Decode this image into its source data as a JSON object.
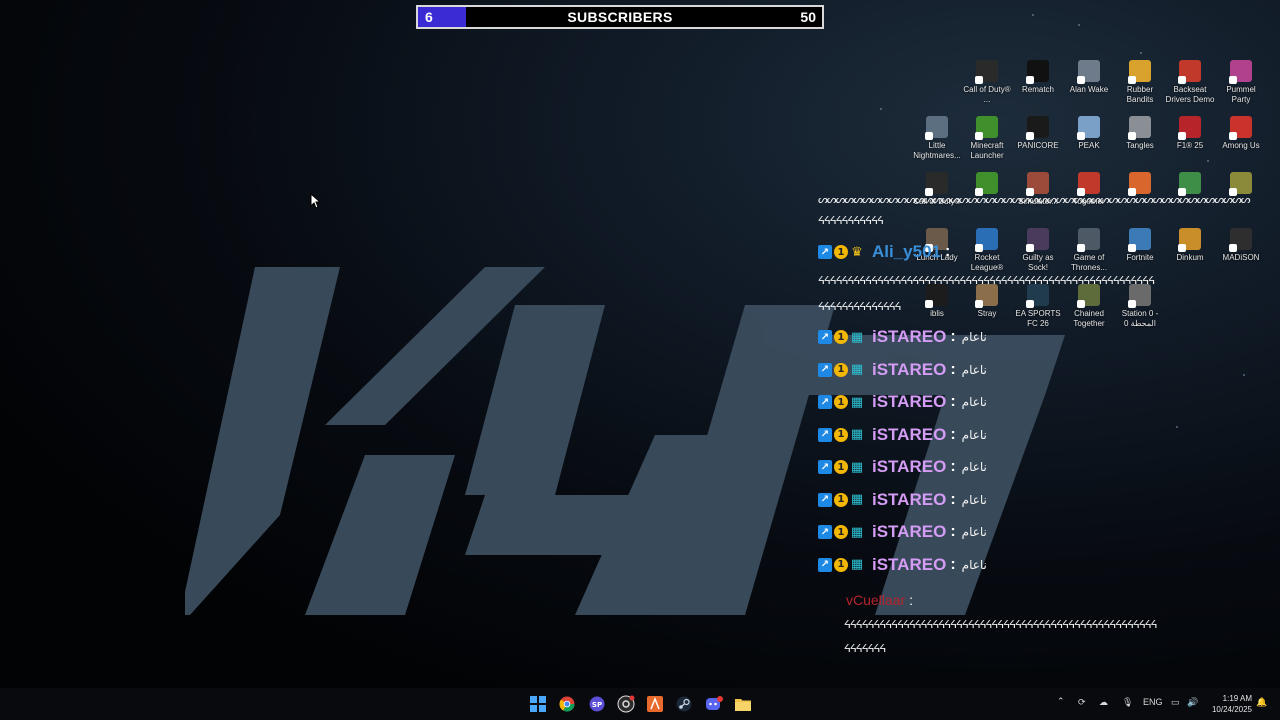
{
  "subscriber_goal": {
    "current": "6",
    "label": "SUBSCRIBERS",
    "target": "50",
    "progress_fraction": 0.12,
    "fill_color": "#3b2bd4"
  },
  "desktop_icons": [
    {
      "label": "Call of Duty® ...",
      "icon": "call-of-duty-icon",
      "color": "#2a2a2a"
    },
    {
      "label": "Rematch",
      "icon": "rematch-icon",
      "color": "#111111"
    },
    {
      "label": "Alan Wake",
      "icon": "alan-wake-icon",
      "color": "#6d7b8a"
    },
    {
      "label": "Rubber Bandits",
      "icon": "rubber-bandits-icon",
      "color": "#d9a22c"
    },
    {
      "label": "Backseat Drivers Demo",
      "icon": "backseat-drivers-icon",
      "color": "#c0392b"
    },
    {
      "label": "Pummel Party",
      "icon": "pummel-party-icon",
      "color": "#b0418c"
    },
    {
      "label": "Little Nightmares...",
      "icon": "little-nightmares-icon",
      "color": "#5b6f80"
    },
    {
      "label": "Minecraft Launcher",
      "icon": "minecraft-icon",
      "color": "#3f8f2d"
    },
    {
      "label": "PANICORE",
      "icon": "panicore-icon",
      "color": "#1a1a1a"
    },
    {
      "label": "PEAK",
      "icon": "peak-icon",
      "color": "#7aa0c8"
    },
    {
      "label": "Tangles",
      "icon": "tangles-icon",
      "color": "#8a8f96"
    },
    {
      "label": "F1® 25",
      "icon": "f1-icon",
      "color": "#b7252b"
    },
    {
      "label": "Among Us",
      "icon": "among-us-icon",
      "color": "#c9332b"
    },
    {
      "label": "Call of Duty®",
      "icon": "call-of-duty-icon",
      "color": "#2a2a2a"
    },
    {
      "label": "",
      "icon": "minecraft-icon",
      "color": "#3f8f2d"
    },
    {
      "label": "Simulator...",
      "icon": "simulator-icon",
      "color": "#9c4b3a"
    },
    {
      "label": "Together",
      "icon": "together-icon",
      "color": "#c0392b"
    },
    {
      "label": "",
      "icon": "game-icon",
      "color": "#d9662c"
    },
    {
      "label": "",
      "icon": "game-icon",
      "color": "#3e8e47"
    },
    {
      "label": "",
      "icon": "game-icon",
      "color": "#8a8a3a"
    },
    {
      "label": "Lunch Lady",
      "icon": "lunch-lady-icon",
      "color": "#6b5a4a"
    },
    {
      "label": "Rocket League®",
      "icon": "rocket-league-icon",
      "color": "#2a6fb5"
    },
    {
      "label": "Guilty as Sock!",
      "icon": "guilty-as-sock-icon",
      "color": "#4a3b5c"
    },
    {
      "label": "Game of Thrones...",
      "icon": "game-of-thrones-icon",
      "color": "#4d5a66"
    },
    {
      "label": "Fortnite",
      "icon": "fortnite-icon",
      "color": "#3b7ab5"
    },
    {
      "label": "Dinkum",
      "icon": "dinkum-icon",
      "color": "#c98d2a"
    },
    {
      "label": "MADiSON",
      "icon": "madison-icon",
      "color": "#2e2e2e"
    },
    {
      "label": "iblis",
      "icon": "iblis-icon",
      "color": "#1c1c1c"
    },
    {
      "label": "Stray",
      "icon": "stray-icon",
      "color": "#8b6e4a"
    },
    {
      "label": "EA SPORTS FC 26",
      "icon": "ea-fc-icon",
      "color": "#1f3b4d"
    },
    {
      "label": "Chained Together",
      "icon": "chained-together-icon",
      "color": "#5e6b3a"
    },
    {
      "label": "Station 0 - المحطة 0",
      "icon": "station-0-icon",
      "color": "#6a6a6a"
    }
  ],
  "chat": {
    "spam_line_1": "ᔕᔕᔕᔕᔕᔕᔕᔕᔕᔕᔕᔕᔕᔕᔕᔕᔕᔕᔕᔕᔕᔕᔕᔕᔕᔕᔕᔕᔕᔕᔕᔕᔕᔕᔕᔕᔕᔕᔕᔕᔕᔕᔕᔕᔕᔕᔕᔕᔕ",
    "spam_line_2": "ᔦᔦᔦᔦᔦᔦᔦᔦᔦᔦᔦ",
    "ali": {
      "name": "Ali_y501",
      "color": "#3a8fd9",
      "colon": ":"
    },
    "spam_line_3": "ᔦᔦᔦᔦᔦᔦᔦᔦᔦᔦᔦᔦᔦᔦᔦᔦᔦᔦᔦᔦᔦᔦᔦᔦᔦᔦᔦᔦᔦᔦᔦᔦᔦᔦᔦᔦᔦᔦᔦᔦᔦᔦᔦᔦᔦᔦᔦᔦᔦᔦᔦᔦᔦᔦᔦᔦᔦ",
    "spam_line_4": "ᔦᔦᔦᔦᔦᔦᔦᔦᔦᔦᔦᔦᔦᔦ",
    "istareo_messages": [
      {
        "name": "iSTAREO",
        "colon": ":",
        "text": "ناعام"
      },
      {
        "name": "iSTAREO",
        "colon": ":",
        "text": "ناعام"
      },
      {
        "name": "iSTAREO",
        "colon": ":",
        "text": "ناعام"
      },
      {
        "name": "iSTAREO",
        "colon": ":",
        "text": "ناعام"
      },
      {
        "name": "iSTAREO",
        "colon": ":",
        "text": "ناعام"
      },
      {
        "name": "iSTAREO",
        "colon": ":",
        "text": "ناعام"
      },
      {
        "name": "iSTAREO",
        "colon": ":",
        "text": "ناعام"
      },
      {
        "name": "iSTAREO",
        "colon": ":",
        "text": "ناعام"
      }
    ],
    "istareo_color": "#d59cf5",
    "cuellaar": {
      "name": "vCuellaar",
      "color": "#b8252e",
      "colon": ":"
    },
    "spam_line_5": "ᔦᔦᔦᔦᔦᔦᔦᔦᔦᔦᔦᔦᔦᔦᔦᔦᔦᔦᔦᔦᔦᔦᔦᔦᔦᔦᔦᔦᔦᔦᔦᔦᔦᔦᔦᔦᔦᔦᔦᔦᔦᔦᔦᔦᔦᔦᔦᔦᔦᔦᔦᔦᔦ",
    "spam_line_6": "ᔦᔦᔦᔦᔦᔦᔦ"
  },
  "taskbar": {
    "apps": [
      "windows-start-icon",
      "chrome-icon",
      "app-icon",
      "obs-icon",
      "app-icon",
      "steam-icon",
      "discord-icon",
      "file-explorer-icon"
    ],
    "tray": {
      "language": "ENG"
    },
    "clock": {
      "time": "1:19 AM",
      "date": "10/24/2025"
    }
  },
  "colors": {
    "wallpaper_logo": "#3b4d5e"
  }
}
